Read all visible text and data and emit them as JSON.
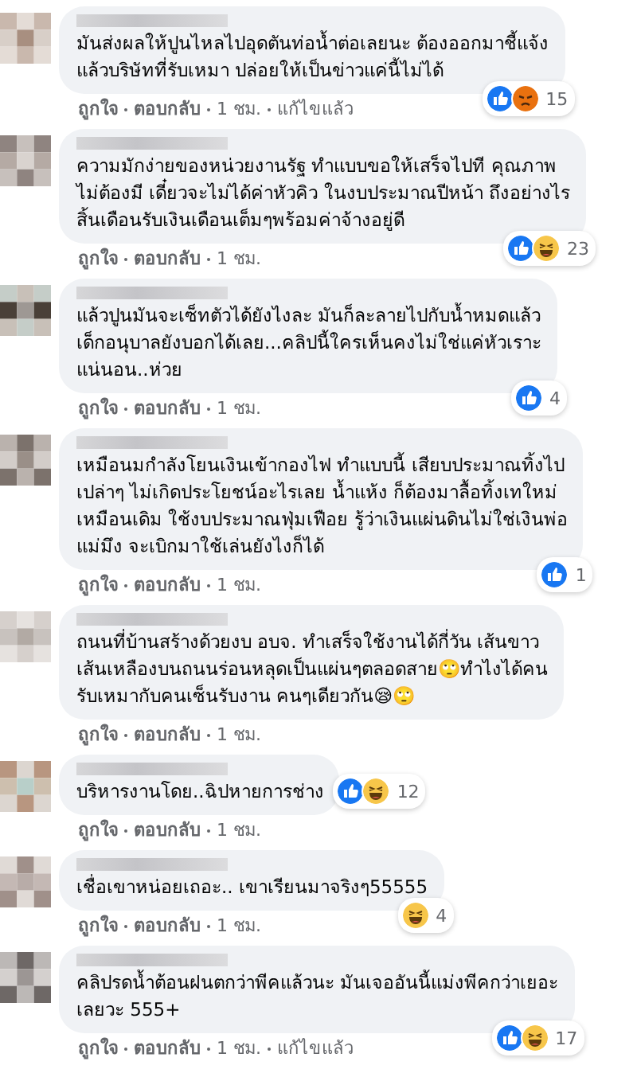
{
  "comments": [
    {
      "text": "มันส่งผลให้ปูนไหลไปอุดตันท่อน้ำต่อเลยนะ ต้องออกมาชี้แจ้ง\nแล้วบริษัทที่รับเหมา ปล่อยให้เป็นข่าวแค่นี้ไม่ได้",
      "reactions": [
        {
          "kind": "like"
        },
        {
          "kind": "angry"
        }
      ],
      "count": "15",
      "actions": [
        "ถูกใจ",
        "ตอบกลับ",
        "1 ชม.",
        "แก้ไขแล้ว"
      ]
    },
    {
      "text": "ความมักง่ายของหน่วยงานรัฐ ทำแบบขอให้เสร็จไปที คุณภาพ\nไม่ต้องมี เดี๋ยวจะไม่ได้ค่าหัวคิว ในงบประมาณปีหน้า ถึงอย่างไร\nสิ้นเดือนรับเงินเดือนเต็มๆพร้อมค่าจ้างอยู่ดี",
      "reactions": [
        {
          "kind": "like"
        },
        {
          "kind": "haha"
        }
      ],
      "count": "23",
      "actions": [
        "ถูกใจ",
        "ตอบกลับ",
        "1 ชม."
      ]
    },
    {
      "text": "แล้วปูนมันจะเซ็ทตัวได้ยังไงละ มันก็ละลายไปกับน้ำหมดแล้ว\nเด็กอนุบาลยังบอกได้เลย...คลิปนี้ใครเห็นคงไม่ใช่แค่หัวเราะ\nแน่นอน..ห่วย",
      "reactions": [
        {
          "kind": "like"
        }
      ],
      "count": "4",
      "actions": [
        "ถูกใจ",
        "ตอบกลับ",
        "1 ชม."
      ]
    },
    {
      "text": "เหมือนมกำลังโยนเงินเข้ากองไฟ ทำแบบนี้ เสียบประมาณทิ้งไป\nเปล่าๆ ไม่เกิดประโยชน์อะไรเลย น้ำแห้ง ก็ต้องมาลื้อทิ้งเทใหม่\nเหมือนเดิม ใช้งบประมาณฟุ่มเฟือย รู้ว่าเงินแผ่นดินไม่ใช่เงินพ่อ\nแม่มึง จะเบิกมาใช้เล่นยังไงก็ได้",
      "reactions": [
        {
          "kind": "like"
        }
      ],
      "count": "1",
      "actions": [
        "ถูกใจ",
        "ตอบกลับ",
        "1 ชม."
      ]
    },
    {
      "text": "ถนนที่บ้านสร้างด้วยงบ อบจ. ทำเสร็จใช้งานได้กี่วัน เส้นขาว\nเส้นเหลืองบนถนนร่อนหลุดเป็นแผ่นๆตลอดสาย🙄ทำไงได้คน\nรับเหมากับคนเซ็นรับงาน คนๆเดียวกัน😪🙄",
      "actions": [
        "ถูกใจ",
        "ตอบกลับ",
        "1 ชม."
      ]
    },
    {
      "text": "บริหารงานโดย..ฉิปหายการช่าง",
      "reactions": [
        {
          "kind": "like"
        },
        {
          "kind": "haha"
        }
      ],
      "count": "12",
      "side": true,
      "actions": [
        "ถูกใจ",
        "ตอบกลับ",
        "1 ชม."
      ]
    },
    {
      "text": "เชื่อเขาหน่อยเถอะ.. เขาเรียนมาจริงๆ55555",
      "reactions": [
        {
          "kind": "haha"
        }
      ],
      "count": "4",
      "actions": [
        "ถูกใจ",
        "ตอบกลับ",
        "1 ชม."
      ]
    },
    {
      "text": "คลิปรดน้ำต้อนฝนตกว่าพีคแล้วนะ มันเจออันนี้แม่งพีคกว่าเยอะ\nเลยวะ 555+",
      "reactions": [
        {
          "kind": "like"
        },
        {
          "kind": "haha"
        }
      ],
      "count": "17",
      "actions": [
        "ถูกใจ",
        "ตอบกลับ",
        "1 ชม.",
        "แก้ไขแล้ว"
      ]
    }
  ]
}
